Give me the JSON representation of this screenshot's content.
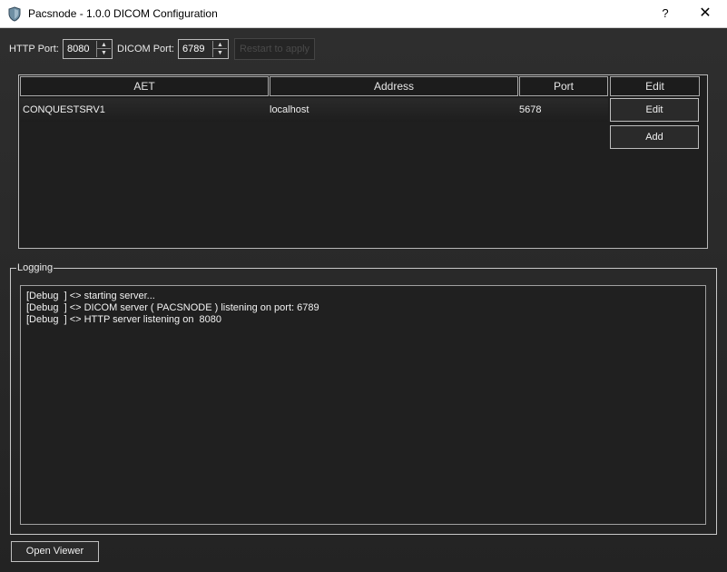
{
  "window": {
    "title": "Pacsnode - 1.0.0 DICOM Configuration",
    "help_label": "?",
    "close_label": "✕"
  },
  "toolbar": {
    "http_port_label": "HTTP Port:",
    "http_port_value": "8080",
    "dicom_port_label": "DICOM Port:",
    "dicom_port_value": "6789",
    "restart_label": "Restart to apply"
  },
  "table": {
    "headers": [
      "AET",
      "Address",
      "Port",
      "Edit"
    ],
    "rows": [
      {
        "aet": "CONQUESTSRV1",
        "address": "localhost",
        "port": "5678",
        "edit_label": "Edit"
      }
    ],
    "add_label": "Add"
  },
  "logging": {
    "title": "Logging",
    "lines": [
      "[Debug  ] <> starting server...",
      "[Debug  ] <> DICOM server ( PACSNODE ) listening on port: 6789",
      "[Debug  ] <> HTTP server listening on  8080"
    ]
  },
  "footer": {
    "open_viewer_label": "Open Viewer"
  }
}
